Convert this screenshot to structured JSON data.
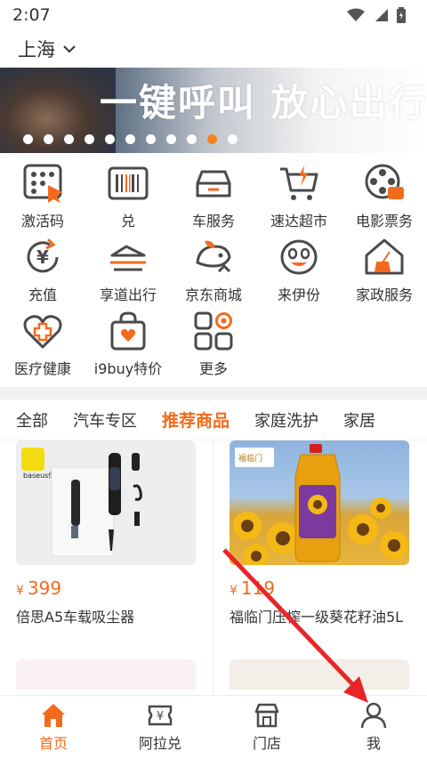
{
  "status": {
    "time": "2:07"
  },
  "city": {
    "name": "上海"
  },
  "banner": {
    "text": "一键呼叫 放心出行",
    "dot_count": 11,
    "active_dot": 9
  },
  "grid": [
    {
      "label": "激活码",
      "icon": "keypad-icon"
    },
    {
      "label": "兑",
      "icon": "barcode-icon"
    },
    {
      "label": "车服务",
      "icon": "car-icon"
    },
    {
      "label": "速达超市",
      "icon": "shopping-cart-icon"
    },
    {
      "label": "电影票务",
      "icon": "film-reel-icon"
    },
    {
      "label": "充值",
      "icon": "yen-refresh-icon"
    },
    {
      "label": "享道出行",
      "icon": "shoe-travel-icon"
    },
    {
      "label": "京东商城",
      "icon": "jd-dog-icon"
    },
    {
      "label": "来伊份",
      "icon": "smiley-icon"
    },
    {
      "label": "家政服务",
      "icon": "house-broom-icon"
    },
    {
      "label": "医疗健康",
      "icon": "medical-heart-icon"
    },
    {
      "label": "i9buy特价",
      "icon": "shopping-bag-heart-icon"
    },
    {
      "label": "更多",
      "icon": "more-grid-icon"
    }
  ],
  "tabs": [
    "全部",
    "汽车专区",
    "推荐商品",
    "家庭洗护",
    "家居"
  ],
  "active_tab": 2,
  "products": [
    {
      "currency": "¥",
      "price": "399",
      "name": "倍思A5车载吸尘器",
      "brand": "baseus倍思"
    },
    {
      "currency": "¥",
      "price": "119",
      "name": "福临门压榨一级葵花籽油5L",
      "brand": "福临门"
    }
  ],
  "bottom_nav": [
    {
      "label": "首页",
      "icon": "home-icon",
      "active": true
    },
    {
      "label": "阿拉兑",
      "icon": "voucher-icon",
      "active": false
    },
    {
      "label": "门店",
      "icon": "store-icon",
      "active": false
    },
    {
      "label": "我",
      "icon": "user-icon",
      "active": false
    }
  ],
  "colors": {
    "accent": "#f26b1d",
    "icon_dark": "#4a4a4a"
  }
}
